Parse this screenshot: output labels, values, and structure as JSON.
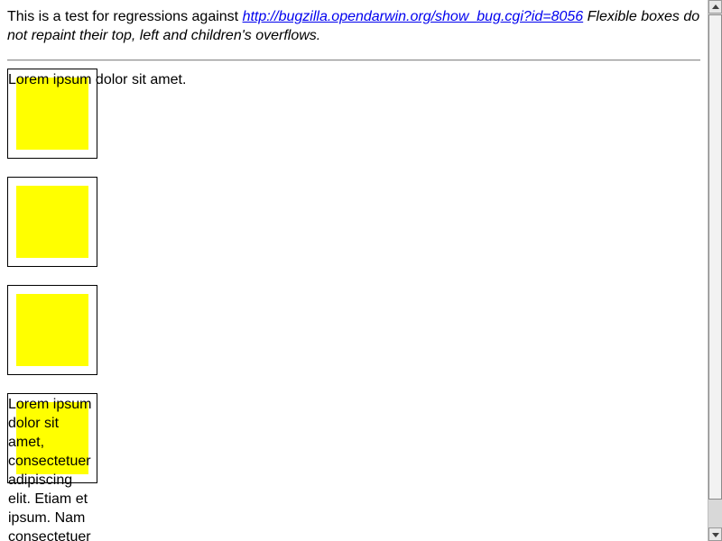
{
  "intro": {
    "prefix": "This is a test for regressions against ",
    "link_text": "http://bugzilla.opendarwin.org/show_bug.cgi?id=8056",
    "description": " Flexible boxes do not repaint their top, left and children's overflows."
  },
  "boxes": [
    {
      "text": "Lorem ipsum dolor sit amet."
    },
    {
      "text": ""
    },
    {
      "text": ""
    },
    {
      "text": "Lorem ipsum dolor sit amet, consectetuer adipiscing elit. Etiam et ipsum. Nam consectetuer"
    }
  ],
  "colors": {
    "fill": "#ffff00",
    "link": "#0000ee",
    "border": "#000000"
  }
}
